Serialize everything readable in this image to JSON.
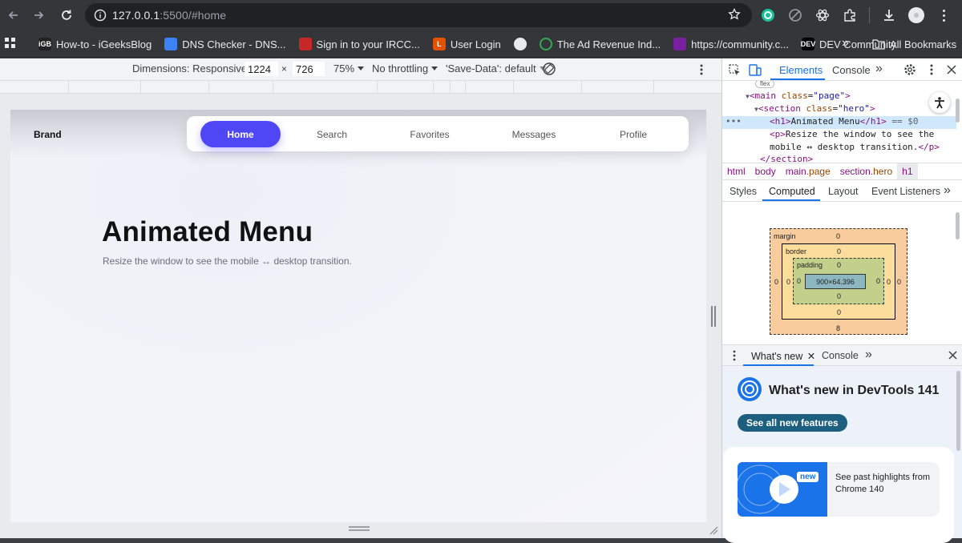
{
  "browser": {
    "url_host": "127.0.0.1",
    "url_rest": ":5500/#home",
    "bookmarks": [
      {
        "label": "How-to - iGeeksBlog",
        "color": "#222222",
        "badge": "iGB"
      },
      {
        "label": "DNS Checker - DNS...",
        "color": "#3b82f6",
        "badge": ""
      },
      {
        "label": "Sign in to your IRCC...",
        "color": "#c62828",
        "badge": ""
      },
      {
        "label": "User Login",
        "color": "#e65100",
        "badge": "L"
      },
      {
        "label": "",
        "color": "#5f6368",
        "badge": ""
      },
      {
        "label": "The Ad Revenue Ind...",
        "color": "#2e7d32",
        "badge": ""
      },
      {
        "label": "https://community.c...",
        "color": "#7b1fa2",
        "badge": ""
      },
      {
        "label": "DEV Community",
        "color": "#000000",
        "badge": "DEV"
      }
    ],
    "bookmarks_overflow": "»",
    "all_bookmarks": "All Bookmarks"
  },
  "device_toolbar": {
    "dimensions": "Dimensions: Responsive",
    "width": "1224",
    "times": "×",
    "height": "726",
    "zoom": "75%",
    "throttling": "No throttling",
    "save_data": "'Save-Data': default"
  },
  "page": {
    "brand": "Brand",
    "menu": [
      "Home",
      "Search",
      "Favorites",
      "Messages",
      "Profile"
    ],
    "active_menu": "Home",
    "accent": "#4f46f5",
    "title": "Animated Menu",
    "subtitle": "Resize the window to see the mobile ↔ desktop transition."
  },
  "devtools": {
    "tabs": [
      "Elements",
      "Console"
    ],
    "more": "»",
    "dom": {
      "flex_badge": "flex",
      "main_tag": "main",
      "main_attr": "class",
      "main_val": "\"page\"",
      "section_tag": "section",
      "section_attr": "class",
      "section_val": "\"hero\"",
      "h1_open": "<h1>",
      "h1_text": "Animated Menu",
      "h1_close": "</h1>",
      "h1_eq": " == $0",
      "p_open": "<p>",
      "p_text1": "Resize the window to see the",
      "p_text2": "mobile ↔ desktop transition.",
      "p_close": "</p>",
      "section_close": "</section>"
    },
    "breadcrumbs": {
      "html": "html",
      "body": "body",
      "main_tag": "main",
      "main_cls": ".page",
      "section_tag": "section",
      "section_cls": ".hero",
      "current": "h1"
    },
    "sub_tabs": [
      "Styles",
      "Computed",
      "Layout",
      "Event Listeners"
    ],
    "box_model": {
      "margin_label": "margin",
      "border_label": "border",
      "padding_label": "padding",
      "content": "900×64.396",
      "margin_top": "0",
      "margin_bottom": "8",
      "margin_left": "0",
      "margin_right": "0",
      "border_top": "0",
      "border_bottom": "0",
      "border_left": "0",
      "border_right": "0",
      "padding_top": "0",
      "padding_bottom": "0",
      "padding_left": "0",
      "padding_right": "0"
    },
    "drawer_tabs": [
      "What's new",
      "Console"
    ],
    "whats_new": {
      "title": "What's new in DevTools 141",
      "button": "See all new features",
      "badge": "new",
      "card_text": "See past highlights from Chrome 140"
    }
  }
}
